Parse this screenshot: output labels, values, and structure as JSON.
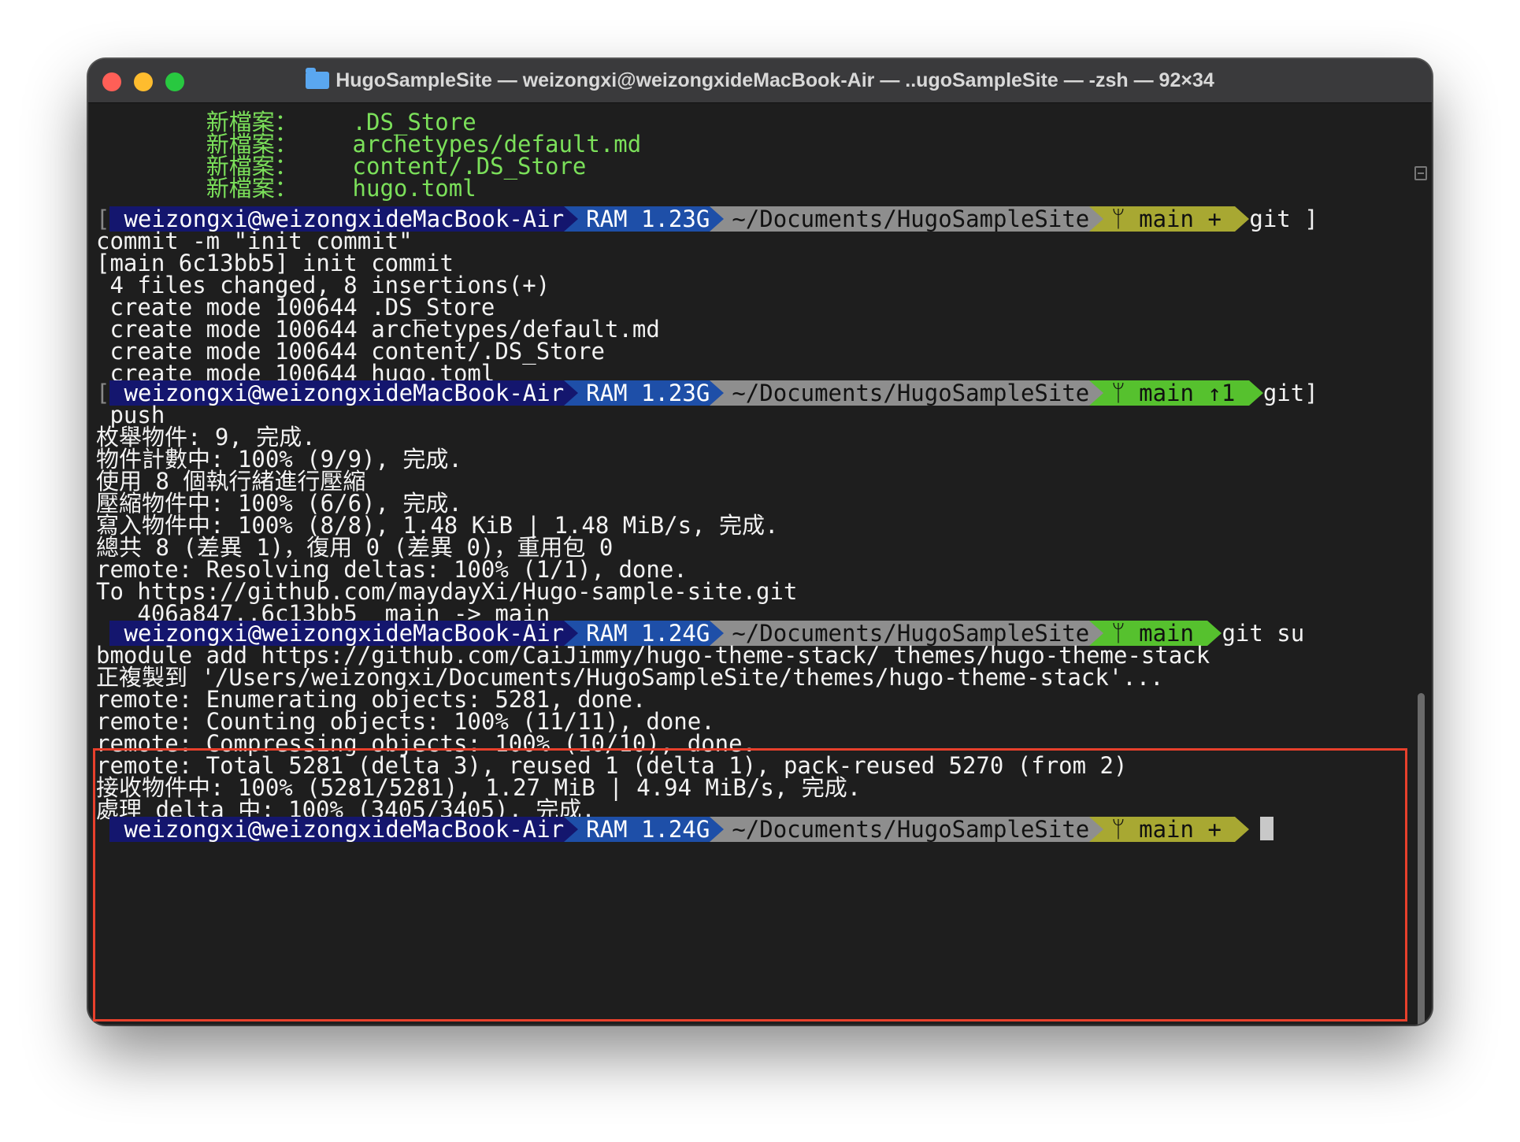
{
  "window": {
    "title": "HugoSampleSite — weizongxi@weizongxideMacBook-Air — ..ugoSampleSite — -zsh — 92×34",
    "title_icon": "folder-icon"
  },
  "colors": {
    "prompt_user_bg": "#14166e",
    "prompt_ram_bg": "#1e4fa8",
    "prompt_path_bg": "#8e8e8e",
    "git_dirty_bg": "#a8a832",
    "git_clean_bg": "#56c12e",
    "highlight_frame": "#e8402c"
  },
  "status_lines": [
    {
      "label": "新檔案：",
      "file": ".DS_Store"
    },
    {
      "label": "新檔案：",
      "file": "archetypes/default.md"
    },
    {
      "label": "新檔案：",
      "file": "content/.DS_Store"
    },
    {
      "label": "新檔案：",
      "file": "hugo.toml"
    }
  ],
  "prompts": [
    {
      "user": "weizongxi@weizongxideMacBook-Air",
      "ram": "RAM 1.23G",
      "path": "~/Documents/HugoSampleSite",
      "branch": "main +",
      "cmd": "git ]",
      "state": "dirty"
    },
    {
      "user": "weizongxi@weizongxideMacBook-Air",
      "ram": "RAM 1.23G",
      "path": "~/Documents/HugoSampleSite",
      "branch": "main ↑1",
      "cmd": "git]",
      "state": "ahead"
    },
    {
      "user": "weizongxi@weizongxideMacBook-Air",
      "ram": "RAM 1.24G",
      "path": "~/Documents/HugoSampleSite",
      "branch": "main",
      "cmd": "git su",
      "state": "clean"
    },
    {
      "user": "weizongxi@weizongxideMacBook-Air",
      "ram": "RAM 1.24G",
      "path": "~/Documents/HugoSampleSite",
      "branch": "main +",
      "cmd": "",
      "state": "dirty"
    }
  ],
  "output": {
    "commit": [
      "commit -m \"init commit\"",
      "[main 6c13bb5] init commit",
      " 4 files changed, 8 insertions(+)",
      " create mode 100644 .DS_Store",
      " create mode 100644 archetypes/default.md",
      " create mode 100644 content/.DS_Store",
      " create mode 100644 hugo.toml"
    ],
    "push": [
      " push",
      "枚舉物件: 9, 完成.",
      "物件計數中: 100% (9/9), 完成.",
      "使用 8 個執行緒進行壓縮",
      "壓縮物件中: 100% (6/6), 完成.",
      "寫入物件中: 100% (8/8), 1.48 KiB | 1.48 MiB/s, 完成.",
      "總共 8 (差異 1)，復用 0 (差異 0)，重用包 0",
      "remote: Resolving deltas: 100% (1/1), done.",
      "To https://github.com/maydayXi/Hugo-sample-site.git",
      "   406a847..6c13bb5  main -> main"
    ],
    "submodule": [
      "bmodule add https://github.com/CaiJimmy/hugo-theme-stack/ themes/hugo-theme-stack",
      "正複製到 '/Users/weizongxi/Documents/HugoSampleSite/themes/hugo-theme-stack'...",
      "remote: Enumerating objects: 5281, done.",
      "remote: Counting objects: 100% (11/11), done.",
      "remote: Compressing objects: 100% (10/10), done.",
      "remote: Total 5281 (delta 3), reused 1 (delta 1), pack-reused 5270 (from 2)",
      "接收物件中: 100% (5281/5281), 1.27 MiB | 4.94 MiB/s, 完成.",
      "處理 delta 中: 100% (3405/3405), 完成."
    ]
  }
}
